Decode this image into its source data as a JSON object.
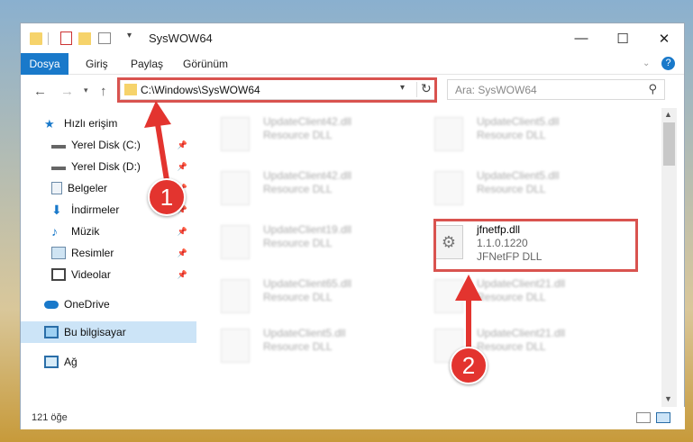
{
  "window": {
    "title": "SysWOW64",
    "controls": {
      "minimize": "—",
      "maximize": "☐",
      "close": "✕"
    }
  },
  "ribbon": {
    "tabs": [
      "Dosya",
      "Giriş",
      "Paylaş",
      "Görünüm"
    ],
    "help": "?"
  },
  "address": {
    "path": "C:\\Windows\\SysWOW64",
    "search_placeholder": "Ara: SysWOW64"
  },
  "sidebar": {
    "items": [
      {
        "label": "Hızlı erişim",
        "icon": "star-icon"
      },
      {
        "label": "Yerel Disk (C:)",
        "icon": "drive-icon"
      },
      {
        "label": "Yerel Disk (D:)",
        "icon": "drive-icon"
      },
      {
        "label": "Belgeler",
        "icon": "documents-icon"
      },
      {
        "label": "İndirmeler",
        "icon": "download-icon"
      },
      {
        "label": "Müzik",
        "icon": "music-icon"
      },
      {
        "label": "Resimler",
        "icon": "pictures-icon"
      },
      {
        "label": "Videolar",
        "icon": "video-icon"
      },
      {
        "label": "OneDrive",
        "icon": "cloud-icon"
      },
      {
        "label": "Bu bilgisayar",
        "icon": "computer-icon"
      },
      {
        "label": "Ağ",
        "icon": "network-icon"
      }
    ]
  },
  "files": [
    {
      "name": "UpdateClient42.dll",
      "type": "Resource DLL"
    },
    {
      "name": "UpdateClient5.dll",
      "type": "Resource DLL"
    },
    {
      "name": "UpdateClient42.dll",
      "type": "Resource DLL"
    },
    {
      "name": "UpdateClient5.dll",
      "type": "Resource DLL"
    },
    {
      "name": "UpdateClient19.dll",
      "type": "Resource DLL"
    },
    {
      "name": "jfnetfp.dll",
      "version": "1.1.0.1220",
      "type": "JFNetFP DLL"
    },
    {
      "name": "UpdateClient65.dll",
      "type": "Resource DLL"
    },
    {
      "name": "UpdateClient21.dll",
      "type": "Resource DLL"
    },
    {
      "name": "UpdateClient5.dll",
      "type": "Resource DLL"
    },
    {
      "name": "UpdateClient21.dll",
      "type": "Resource DLL"
    }
  ],
  "status": {
    "count": "121 öğe"
  },
  "annotations": {
    "step1": "1",
    "step2": "2",
    "color": "#e3342f"
  }
}
